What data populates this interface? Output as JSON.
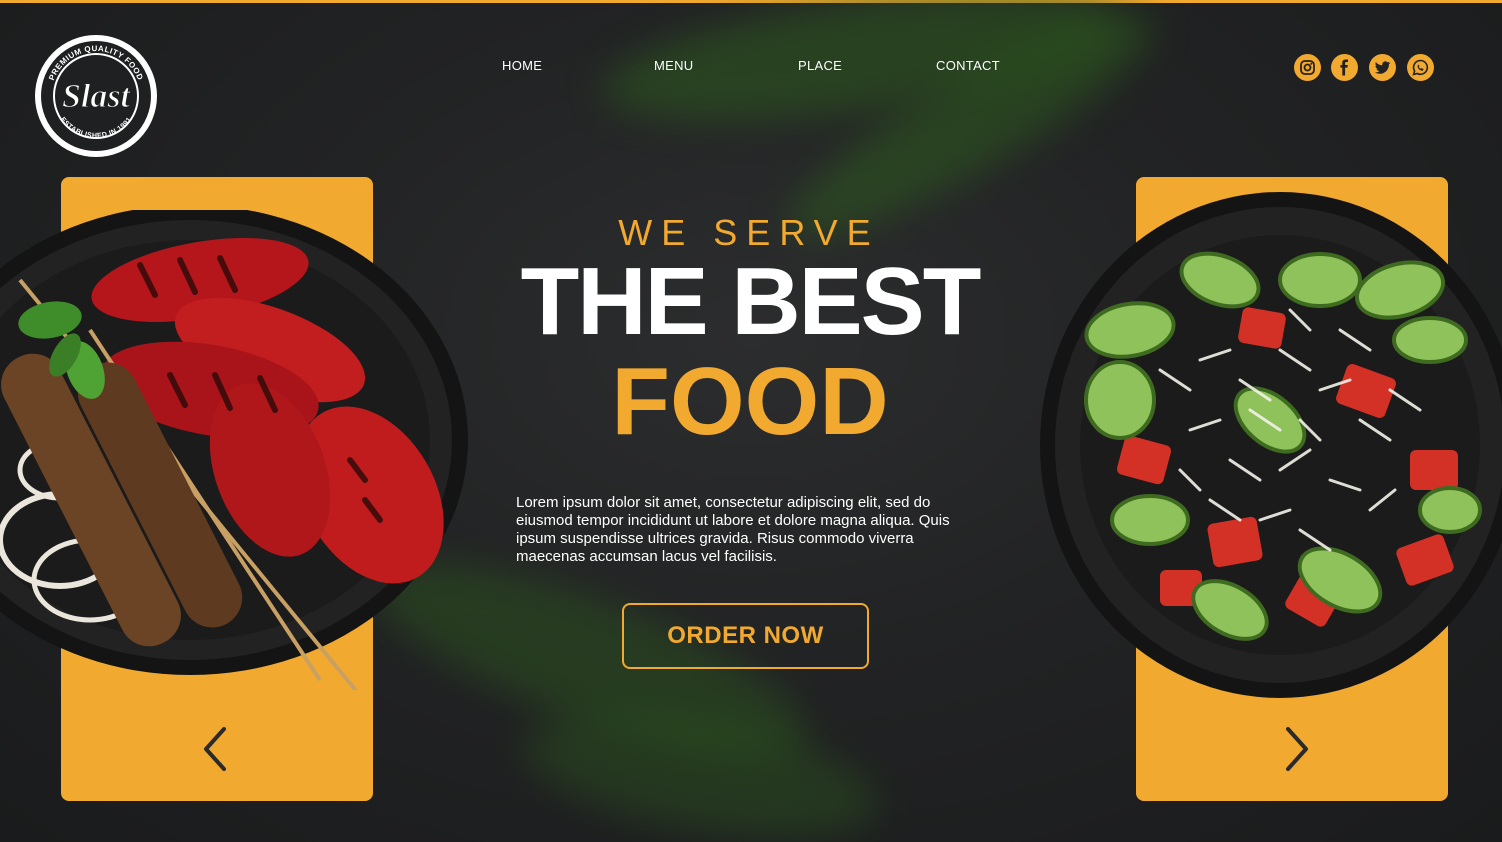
{
  "brand": {
    "logo_script": "Slast",
    "logo_arc_top": "PREMIUM QUALITY FOOD",
    "logo_arc_bottom": "ESTABLISHED IN 1991"
  },
  "nav": {
    "items": [
      {
        "label": "HOME"
      },
      {
        "label": "MENU"
      },
      {
        "label": "PLACE"
      },
      {
        "label": "CONTACT"
      }
    ]
  },
  "social": [
    "instagram-icon",
    "facebook-icon",
    "twitter-icon",
    "whatsapp-icon"
  ],
  "hero": {
    "kicker": "WE SERVE",
    "title_line1": "THE BEST",
    "title_line2": "FOOD",
    "description": "Lorem ipsum dolor sit amet, consectetur adipiscing elit, sed do eiusmod tempor incididunt ut labore et dolore magna aliqua. Quis ipsum suspendisse ultrices gravida. Risus commodo viverra maecenas accumsan lacus vel facilisis.",
    "cta_label": "ORDER NOW"
  },
  "carousel": {
    "prev_icon": "chevron-left-icon",
    "next_icon": "chevron-right-icon"
  },
  "colors": {
    "accent": "#f2a92f",
    "background": "#232425",
    "text": "#ffffff"
  }
}
